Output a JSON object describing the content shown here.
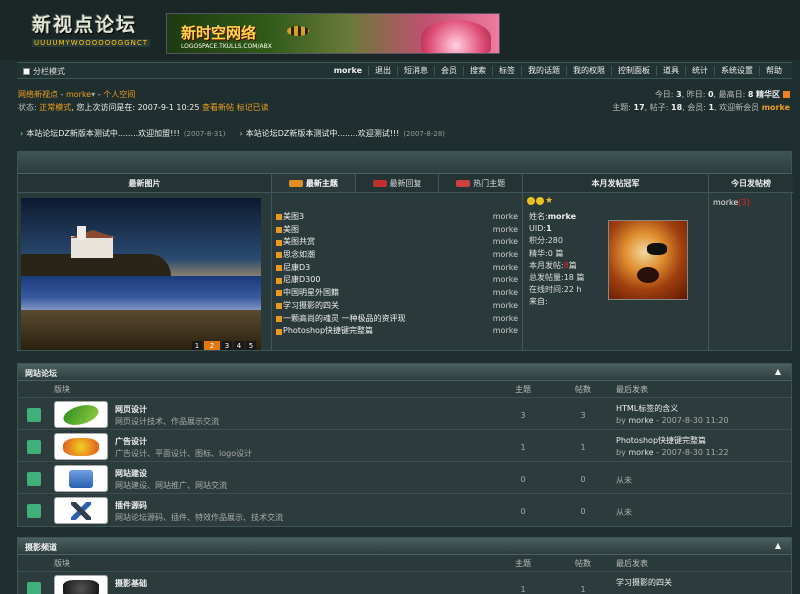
{
  "header": {
    "logo_text": "新视点论坛",
    "logo_sub": "UUUUMYWOOOOOOGGNCT",
    "banner_text": "新时空网络",
    "banner_url": "LOGOSPACE.TKULLS.COM/ABX"
  },
  "nav": {
    "mode_label": "分栏模式",
    "items": [
      "morke",
      "退出",
      "短消息",
      "会员",
      "搜索",
      "标签",
      "我的话题",
      "我的权限",
      "控制面板",
      "道具",
      "统计",
      "系统设置",
      "帮助"
    ]
  },
  "userbar": {
    "site": "网络新视点",
    "user": "morke",
    "space": "个人空间",
    "status_label": "状态: ",
    "status_value": "正常模式",
    "last_visit": ", 您上次访问是在: 2007-9-1 10:25",
    "new_posts": "查看新帖",
    "mark_read": "标记已读"
  },
  "stats": {
    "line1_prefix": "今日: ",
    "today": "3",
    "yesterday_label": ", 昨日: ",
    "yesterday": "0",
    "max_label": ", 最高日: ",
    "max": "8",
    "digest": "精华区",
    "line2_prefix": "主题: ",
    "topics": "17",
    "posts_label": ", 帖子: ",
    "posts": "18",
    "members_label": ", 会员: ",
    "members": "1",
    "welcome": ", 欢迎新会员 ",
    "newest": "morke"
  },
  "announcements": [
    {
      "text": "本站论坛DZ新版本测试中........欢迎加盟!!!",
      "date": "(2007-8-31)"
    },
    {
      "text": "本站论坛DZ新版本测试中........欢迎测试!!!",
      "date": "(2007-8-28)"
    }
  ],
  "portal": {
    "latest_images": "最新图片",
    "tabs": [
      {
        "label": "最新主题",
        "icon": "new-badge-icon"
      },
      {
        "label": "最新回复",
        "icon": "reply-badge-icon"
      },
      {
        "label": "热门主题",
        "icon": "hot-badge-icon"
      }
    ],
    "champion_title": "本月发帖冠军",
    "today_title": "今日发帖榜",
    "pager": [
      "1",
      "2",
      "3",
      "4",
      "5"
    ],
    "threads": [
      {
        "title": "美图3",
        "author": "morke"
      },
      {
        "title": "美图",
        "author": "morke"
      },
      {
        "title": "美图共赏",
        "author": "morke"
      },
      {
        "title": "思念如潮",
        "author": "morke"
      },
      {
        "title": "尼康D3",
        "author": "morke"
      },
      {
        "title": "尼康D300",
        "author": "morke"
      },
      {
        "title": "中国明星外国籍",
        "author": "morke"
      },
      {
        "title": "学习摄影的四关",
        "author": "morke"
      },
      {
        "title": "一颗高尚的魂灵  一种极品的资评现",
        "author": "morke"
      },
      {
        "title": "Photoshop快捷键完整篇",
        "author": "morke"
      }
    ],
    "champion": {
      "name_label": "姓名:",
      "name": "morke",
      "uid_label": "UID:",
      "uid": "1",
      "points_label": "积分:",
      "points": "280",
      "digest_label": "精华:",
      "digest": "0 篇",
      "month_label": "本月发帖:",
      "month": "8",
      "month_unit": "篇",
      "total_label": "总发帖量:",
      "total": "18 篇",
      "online_label": "在线时间:",
      "online": "22 h",
      "from_label": "来自:",
      "from": ""
    },
    "today_user": "morke",
    "today_count": "[3]"
  },
  "forum1": {
    "title": "网站论坛",
    "collapse": "▲",
    "col_board": "版块",
    "col_topics": "主题",
    "col_posts": "帖数",
    "col_last": "最后发表",
    "rows": [
      {
        "name": "网页设计",
        "desc": "网页设计技术、作品展示交流",
        "topics": "3",
        "posts": "3",
        "last_title": "HTML标签的含义",
        "by": "by ",
        "last_user": "morke",
        "last_time": " - 2007-8-30 11:20"
      },
      {
        "name": "广告设计",
        "desc": "广告设计、平面设计、图标、logo设计",
        "topics": "1",
        "posts": "1",
        "last_title": "Photoshop快捷键完整篇",
        "by": "by ",
        "last_user": "morke",
        "last_time": " - 2007-8-30 11:22"
      },
      {
        "name": "网站建设",
        "desc": "网站建设、网站推广、网站交流",
        "topics": "0",
        "posts": "0",
        "none": "从未"
      },
      {
        "name": "插件源码",
        "desc": "网站论坛源码、插件、特效作品展示、技术交流",
        "topics": "0",
        "posts": "0",
        "none": "从未"
      }
    ]
  },
  "forum2": {
    "title": "摄影频道",
    "collapse": "▲",
    "col_board": "版块",
    "col_topics": "主题",
    "col_posts": "帖数",
    "col_last": "最后发表",
    "rows": [
      {
        "name": "摄影基础",
        "topics": "1",
        "posts": "1",
        "last_title": "学习摄影的四关"
      }
    ]
  }
}
